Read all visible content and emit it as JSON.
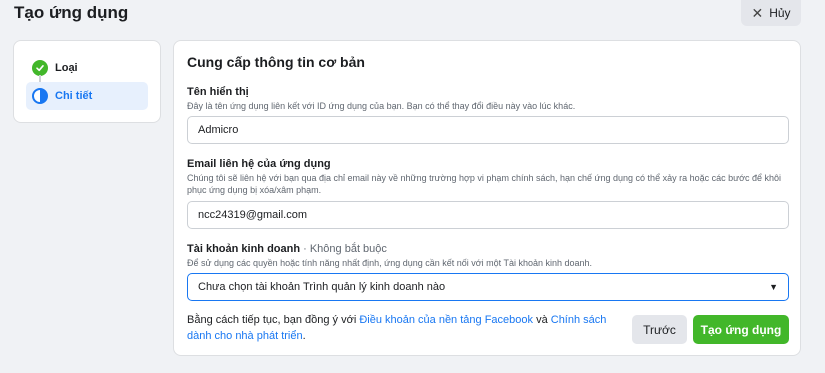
{
  "header": {
    "title": "Tạo ứng dụng",
    "cancel_label": "Hủy"
  },
  "steps": [
    {
      "label": "Loại",
      "state": "complete"
    },
    {
      "label": "Chi tiết",
      "state": "current"
    }
  ],
  "form": {
    "title": "Cung cấp thông tin cơ bản",
    "display_name": {
      "label": "Tên hiển thị",
      "help": "Đây là tên ứng dụng liên kết với ID ứng dụng của bạn. Bạn có thể thay đổi điều này vào lúc khác.",
      "value": "Admicro"
    },
    "email": {
      "label": "Email liên hệ của ứng dụng",
      "help": "Chúng tôi sẽ liên hệ với bạn qua địa chỉ email này về những trường hợp vi phạm chính sách, hạn chế ứng dụng có thể xảy ra hoặc các bước để khôi phục ứng dụng bị xóa/xâm phạm.",
      "value": "ncc24319@gmail.com"
    },
    "business": {
      "label": "Tài khoản kinh doanh",
      "optional": "· Không bắt buộc",
      "help": "Để sử dụng các quyền hoặc tính năng nhất định, ứng dụng cần kết nối với một Tài khoản kinh doanh.",
      "selected": "Chưa chọn tài khoản Trình quản lý kinh doanh nào"
    },
    "terms": {
      "prefix": "Bằng cách tiếp tục, bạn đồng ý với ",
      "link1": "Điều khoản của nền tảng Facebook",
      "middle": " và ",
      "link2": "Chính sách dành cho nhà phát triển",
      "suffix": "."
    },
    "prev_label": "Trước",
    "create_label": "Tạo ứng dụng"
  },
  "colors": {
    "accent": "#1877f2",
    "success": "#42b72a"
  }
}
